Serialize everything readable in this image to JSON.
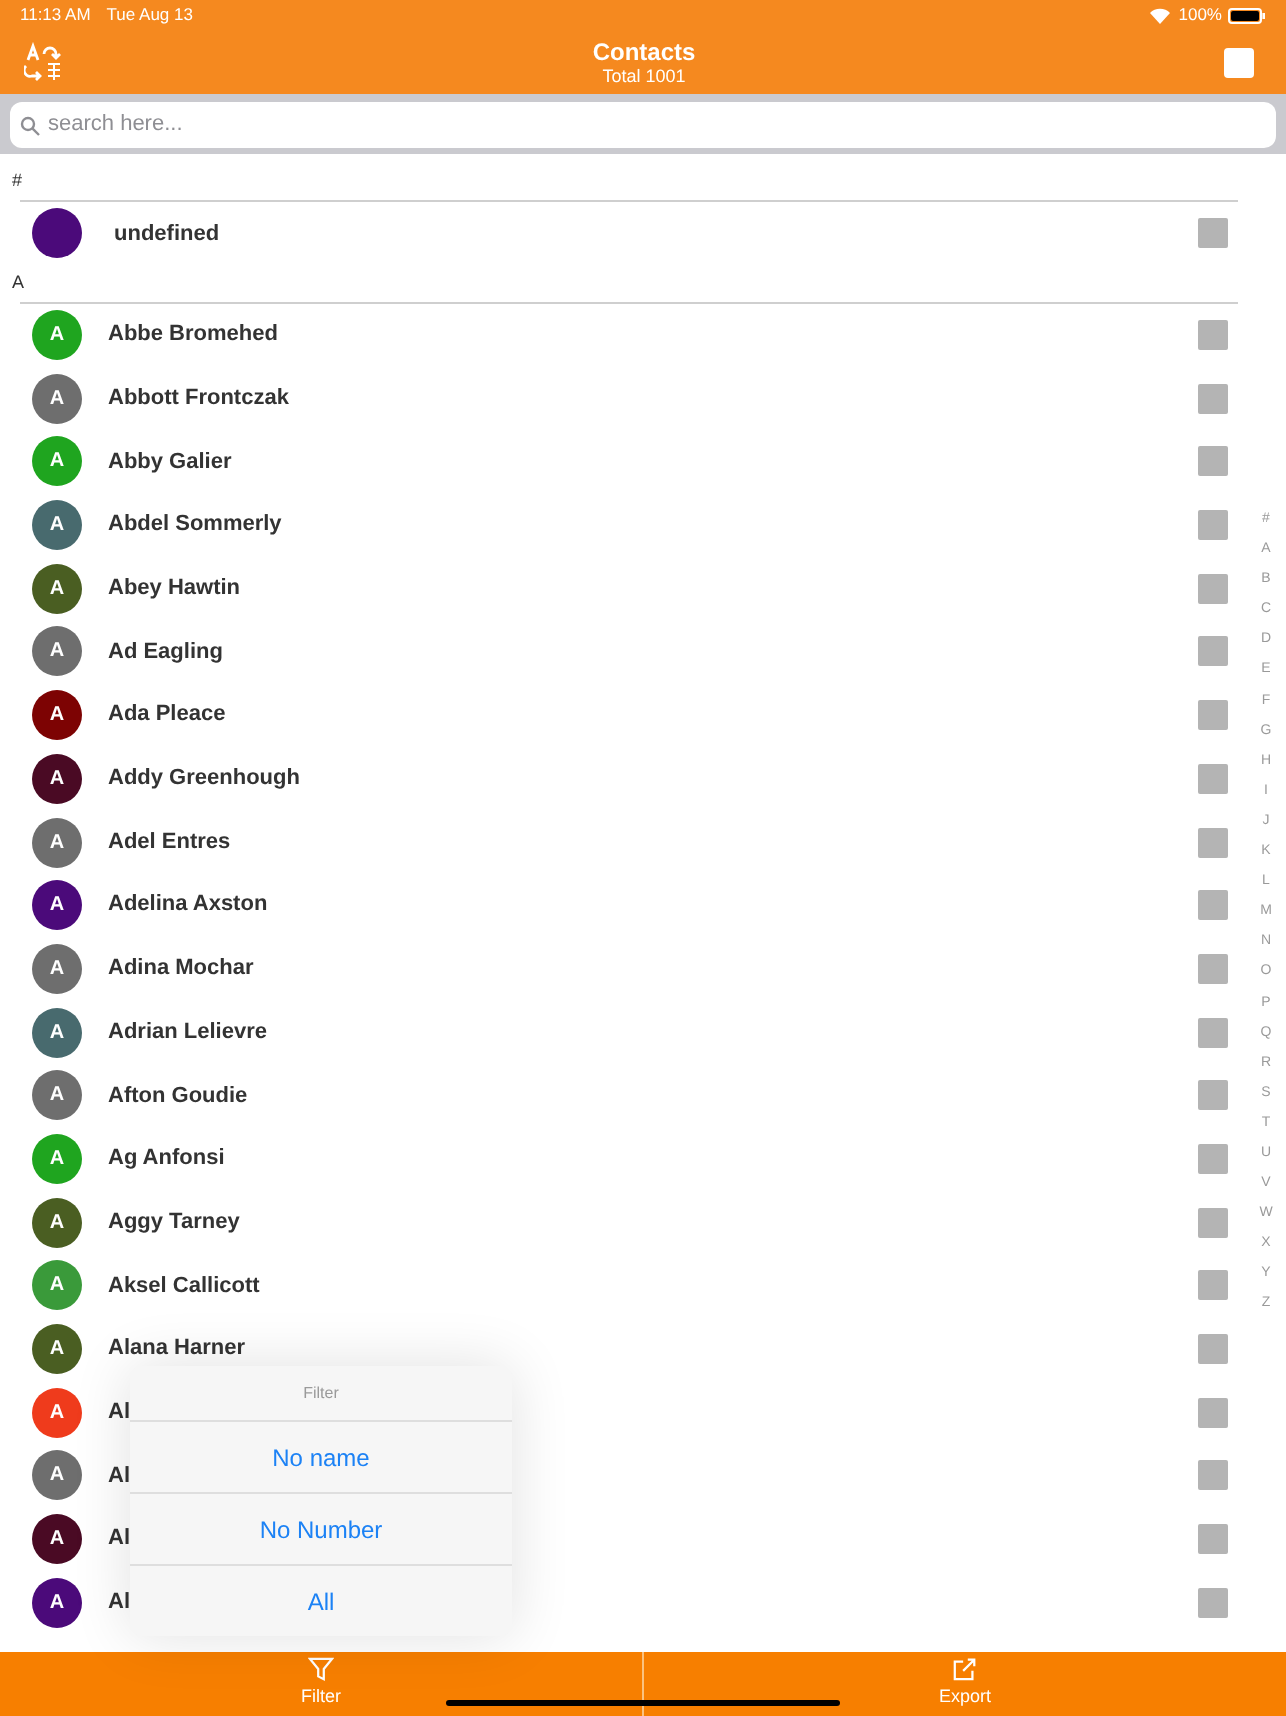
{
  "status_bar": {
    "time": "11:13 AM",
    "date": "Tue Aug 13",
    "battery": "100%"
  },
  "nav": {
    "title": "Contacts",
    "subtitle": "Total 1001",
    "select_all": {
      "checked": false
    }
  },
  "search": {
    "placeholder": "search here..."
  },
  "sections": [
    {
      "header": "#",
      "contacts": [
        {
          "name": "undefined",
          "color": "#4b0a7a",
          "checked": false
        }
      ]
    },
    {
      "header": "A",
      "contacts": [
        {
          "name": "Abbe Bromehed",
          "initial": "A",
          "color": "#1fa51f",
          "checked": false
        },
        {
          "name": "Abbott Frontczak",
          "initial": "A",
          "color": "#6e6e6e",
          "checked": false
        },
        {
          "name": "Abby Galier",
          "initial": "A",
          "color": "#1fa51f",
          "checked": false
        },
        {
          "name": "Abdel Sommerly",
          "initial": "A",
          "color": "#486a6e",
          "checked": false
        },
        {
          "name": "Abey Hawtin",
          "initial": "A",
          "color": "#4a5e22",
          "checked": false
        },
        {
          "name": "Ad Eagling",
          "initial": "A",
          "color": "#6e6e6e",
          "checked": false
        },
        {
          "name": "Ada Pleace",
          "initial": "A",
          "color": "#7d0303",
          "checked": false
        },
        {
          "name": "Addy Greenhough",
          "initial": "A",
          "color": "#4a0a24",
          "checked": false
        },
        {
          "name": "Adel Entres",
          "initial": "A",
          "color": "#6e6e6e",
          "checked": false
        },
        {
          "name": "Adelina Axston",
          "initial": "A",
          "color": "#4b0a7a",
          "checked": false
        },
        {
          "name": "Adina Mochar",
          "initial": "A",
          "color": "#6e6e6e",
          "checked": false
        },
        {
          "name": "Adrian Lelievre",
          "initial": "A",
          "color": "#486a6e",
          "checked": false
        },
        {
          "name": "Afton Goudie",
          "initial": "A",
          "color": "#6e6e6e",
          "checked": false
        },
        {
          "name": "Ag Anfonsi",
          "initial": "A",
          "color": "#1fa51f",
          "checked": false
        },
        {
          "name": "Aggy Tarney",
          "initial": "A",
          "color": "#4a5e22",
          "checked": false
        },
        {
          "name": "Aksel Callicott",
          "initial": "A",
          "color": "#3a9a3a",
          "checked": false
        },
        {
          "name": "Alana Harner",
          "initial": "A",
          "color": "#4a5e22",
          "checked": false
        },
        {
          "name": "Al",
          "initial": "A",
          "color": "#ef3b1c",
          "checked": false
        },
        {
          "name": "Al",
          "initial": "A",
          "color": "#6e6e6e",
          "checked": false
        },
        {
          "name": "Al",
          "initial": "A",
          "color": "#4a0a24",
          "checked": false
        },
        {
          "name": "Al",
          "initial": "A",
          "color": "#4b0a7a",
          "checked": false
        }
      ]
    }
  ],
  "index": [
    "#",
    "A",
    "B",
    "C",
    "D",
    "E",
    "F",
    "G",
    "H",
    "I",
    "J",
    "K",
    "L",
    "M",
    "N",
    "O",
    "P",
    "Q",
    "R",
    "S",
    "T",
    "U",
    "V",
    "W",
    "X",
    "Y",
    "Z"
  ],
  "popover": {
    "title": "Filter",
    "options": [
      "No name",
      "No Number",
      "All"
    ]
  },
  "tab_bar": [
    {
      "label": "Filter",
      "kind": "filter"
    },
    {
      "label": "Export",
      "kind": "export"
    }
  ]
}
